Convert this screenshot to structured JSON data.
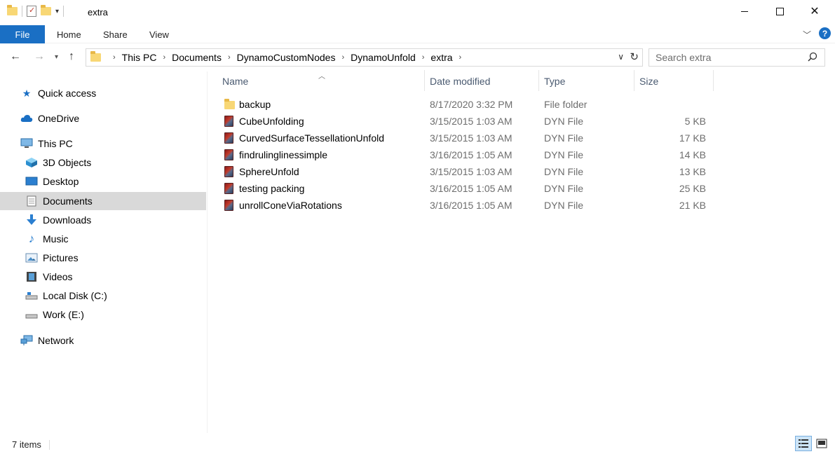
{
  "window": {
    "title": "extra",
    "controls": {
      "minimize": "minimize",
      "maximize": "maximize",
      "close": "close"
    }
  },
  "ribbon": {
    "tabs": [
      "File",
      "Home",
      "Share",
      "View"
    ]
  },
  "address": {
    "crumbs": [
      "This PC",
      "Documents",
      "DynamoCustomNodes",
      "DynamoUnfold",
      "extra"
    ]
  },
  "search": {
    "placeholder": "Search extra"
  },
  "nav": {
    "items": [
      {
        "label": "Quick access",
        "icon": "star-icon",
        "level": 1
      },
      {
        "label": "OneDrive",
        "icon": "cloud-icon",
        "level": 1
      },
      {
        "label": "This PC",
        "icon": "computer-icon",
        "level": 1
      },
      {
        "label": "3D Objects",
        "icon": "cube-icon",
        "level": 2
      },
      {
        "label": "Desktop",
        "icon": "desktop-icon",
        "level": 2
      },
      {
        "label": "Documents",
        "icon": "document-icon",
        "level": 2,
        "selected": true
      },
      {
        "label": "Downloads",
        "icon": "download-icon",
        "level": 2
      },
      {
        "label": "Music",
        "icon": "music-icon",
        "level": 2
      },
      {
        "label": "Pictures",
        "icon": "picture-icon",
        "level": 2
      },
      {
        "label": "Videos",
        "icon": "video-icon",
        "level": 2
      },
      {
        "label": "Local Disk (C:)",
        "icon": "drive-icon",
        "level": 2
      },
      {
        "label": "Work (E:)",
        "icon": "drive-icon",
        "level": 2
      },
      {
        "label": "Network",
        "icon": "network-icon",
        "level": 1
      }
    ]
  },
  "columns": {
    "name": "Name",
    "date": "Date modified",
    "type": "Type",
    "size": "Size"
  },
  "files": [
    {
      "name": "backup",
      "date": "8/17/2020 3:32 PM",
      "type": "File folder",
      "size": "",
      "icon": "folder-icon"
    },
    {
      "name": "CubeUnfolding",
      "date": "3/15/2015 1:03 AM",
      "type": "DYN File",
      "size": "5 KB",
      "icon": "dyn-file-icon"
    },
    {
      "name": "CurvedSurfaceTessellationUnfold",
      "date": "3/15/2015 1:03 AM",
      "type": "DYN File",
      "size": "17 KB",
      "icon": "dyn-file-icon"
    },
    {
      "name": "findrulinglinessimple",
      "date": "3/16/2015 1:05 AM",
      "type": "DYN File",
      "size": "14 KB",
      "icon": "dyn-file-icon"
    },
    {
      "name": "SphereUnfold",
      "date": "3/15/2015 1:03 AM",
      "type": "DYN File",
      "size": "13 KB",
      "icon": "dyn-file-icon"
    },
    {
      "name": "testing packing",
      "date": "3/16/2015 1:05 AM",
      "type": "DYN File",
      "size": "25 KB",
      "icon": "dyn-file-icon"
    },
    {
      "name": "unrollConeViaRotations",
      "date": "3/16/2015 1:05 AM",
      "type": "DYN File",
      "size": "21 KB",
      "icon": "dyn-file-icon"
    }
  ],
  "status": {
    "count": "7 items"
  },
  "colors": {
    "accent": "#1a6fc4",
    "selected": "#d9d9d9",
    "muted_text": "#6d6d6d"
  }
}
